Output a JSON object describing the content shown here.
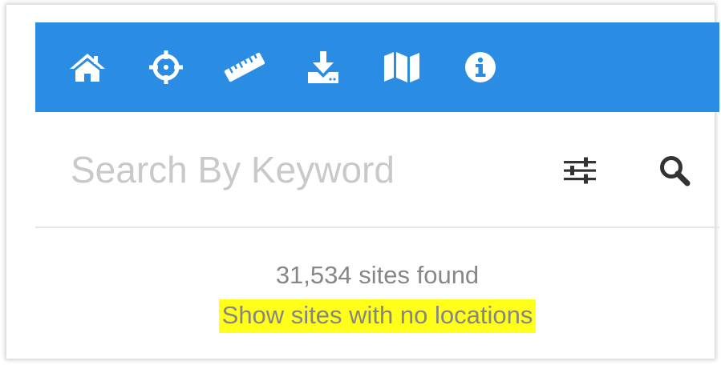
{
  "toolbar": {
    "background": "#2b8ce3",
    "items": [
      {
        "icon": "home-icon"
      },
      {
        "icon": "crosshair-icon"
      },
      {
        "icon": "ruler-icon"
      },
      {
        "icon": "download-icon"
      },
      {
        "icon": "map-icon"
      },
      {
        "icon": "info-icon"
      }
    ]
  },
  "search": {
    "placeholder": "Search By Keyword",
    "value": ""
  },
  "results": {
    "count_text": "31,534 sites found",
    "no_locations_link": "Show sites with no locations",
    "highlight_color": "#ffff1a"
  }
}
